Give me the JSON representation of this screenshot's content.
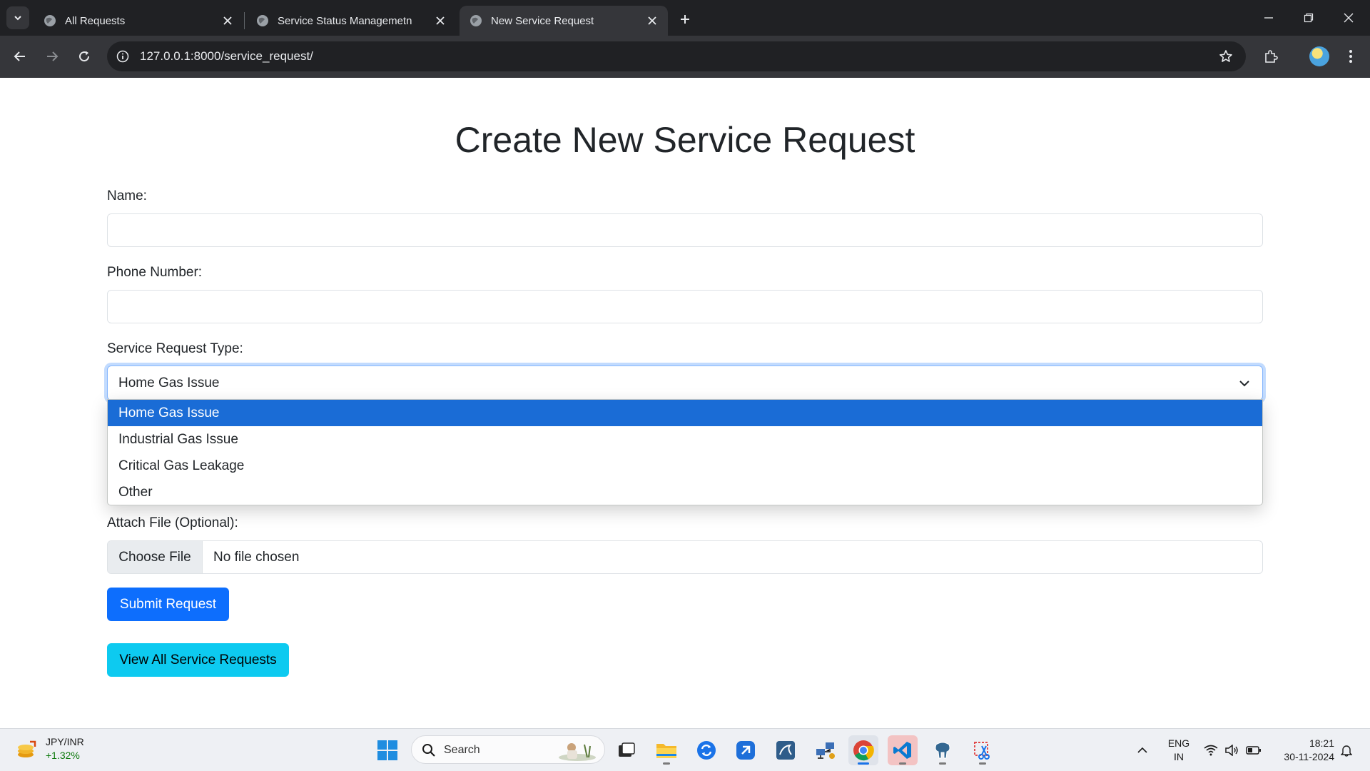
{
  "browser": {
    "tabs": [
      {
        "label": "All Requests",
        "active": false
      },
      {
        "label": "Service Status Managemetn",
        "active": false
      },
      {
        "label": "New Service Request",
        "active": true
      }
    ],
    "url": "127.0.0.1:8000/service_request/"
  },
  "form": {
    "title": "Create New Service Request",
    "name_label": "Name:",
    "name_value": "",
    "phone_label": "Phone Number:",
    "phone_value": "",
    "type_label": "Service Request Type:",
    "type_selected": "Home Gas Issue",
    "type_options": [
      "Home Gas Issue",
      "Industrial Gas Issue",
      "Critical Gas Leakage",
      "Other"
    ],
    "file_label": "Attach File (Optional):",
    "file_button": "Choose File",
    "file_status": "No file chosen",
    "submit_label": "Submit Request",
    "view_all_label": "View All Service Requests"
  },
  "taskbar": {
    "widget_title": "JPY/INR",
    "widget_value": "+1.32%",
    "search_placeholder": "Search",
    "lang_line1": "ENG",
    "lang_line2": "IN",
    "time": "18:21",
    "date": "30-11-2024"
  },
  "colors": {
    "primary": "#0d6efd",
    "info": "#0dcaf0",
    "selected_option": "#1a6cd6",
    "chrome_dark": "#202124"
  }
}
